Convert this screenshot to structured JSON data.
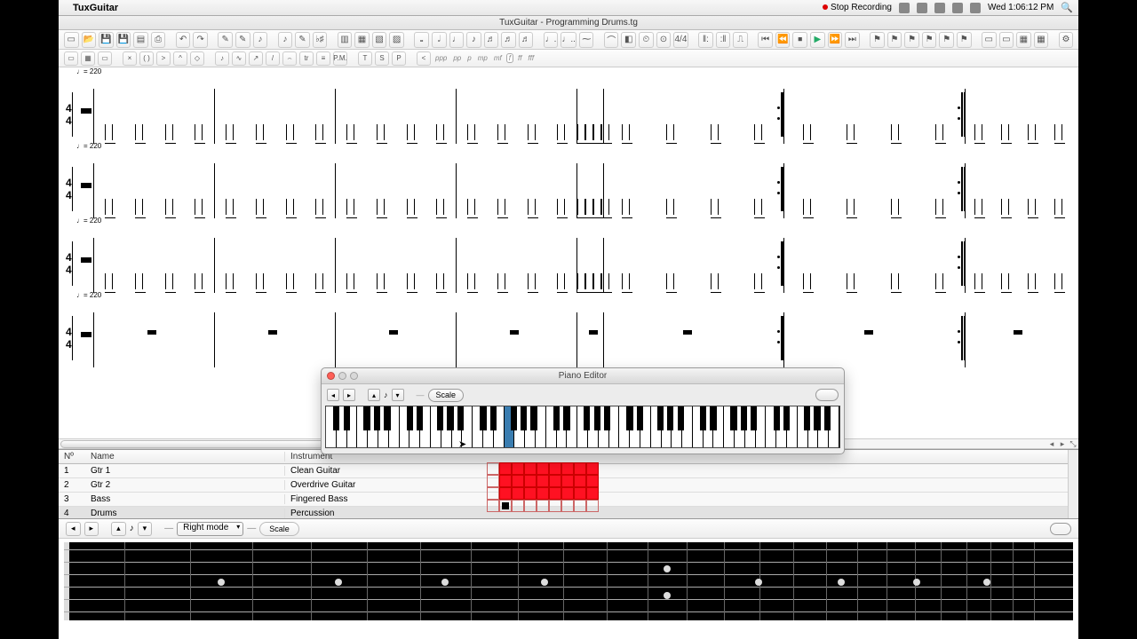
{
  "menubar": {
    "app": "TuxGuitar",
    "stop_rec": "Stop Recording",
    "clock": "Wed 1:06:12 PM"
  },
  "window": {
    "title": "TuxGuitar - Programming Drums.tg"
  },
  "piano": {
    "title": "Piano Editor",
    "scale": "Scale",
    "highlighted_note": "F3"
  },
  "tracks": {
    "header": {
      "num": "Nº",
      "name": "Name",
      "instr": "Instrument"
    },
    "rows": [
      {
        "n": "1",
        "name": "Gtr 1",
        "instr": "Clean Guitar"
      },
      {
        "n": "2",
        "name": "Gtr 2",
        "instr": "Overdrive Guitar"
      },
      {
        "n": "3",
        "name": "Bass",
        "instr": "Fingered Bass"
      },
      {
        "n": "4",
        "name": "Drums",
        "instr": "Percussion"
      }
    ],
    "selected": 3
  },
  "fret": {
    "mode": "Right mode",
    "scale": "Scale"
  },
  "score": {
    "tempo_label": "♩= 220",
    "timesig_num": "4",
    "timesig_den": "4"
  },
  "dyn": [
    "ppp",
    "pp",
    "p",
    "mp",
    "mf",
    "f",
    "ff",
    "fff"
  ]
}
